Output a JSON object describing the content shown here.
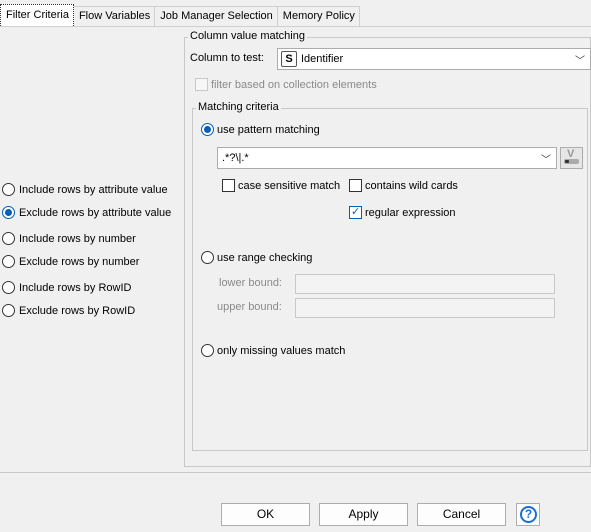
{
  "tabs": [
    {
      "label": "Filter Criteria"
    },
    {
      "label": "Flow Variables"
    },
    {
      "label": "Job Manager Selection"
    },
    {
      "label": "Memory Policy"
    }
  ],
  "filter_options": [
    {
      "label": "Include rows by attribute value",
      "selected": false
    },
    {
      "label": "Exclude rows by attribute value",
      "selected": true
    },
    {
      "label": "Include rows by number",
      "selected": false
    },
    {
      "label": "Exclude rows by number",
      "selected": false
    },
    {
      "label": "Include rows by RowID",
      "selected": false
    },
    {
      "label": "Exclude rows by RowID",
      "selected": false
    }
  ],
  "column_matching": {
    "title": "Column value matching",
    "column_label": "Column to test:",
    "column_type_badge": "S",
    "column_value": "Identifier",
    "collection_label": "filter based on collection elements"
  },
  "matching": {
    "title": "Matching criteria",
    "pattern_label": "use pattern matching",
    "pattern_value": ".*?\\|.*",
    "variable_button_letter": "V",
    "case_sensitive_label": "case sensitive match",
    "wildcards_label": "contains wild cards",
    "regex_label": "regular expression",
    "range_label": "use range checking",
    "lower_label": "lower bound:",
    "upper_label": "upper bound:",
    "missing_label": "only missing values match"
  },
  "buttons": {
    "ok": "OK",
    "apply": "Apply",
    "cancel": "Cancel",
    "help": "?"
  },
  "colors": {
    "accent": "#005fb8",
    "help": "#1a6fd0"
  }
}
